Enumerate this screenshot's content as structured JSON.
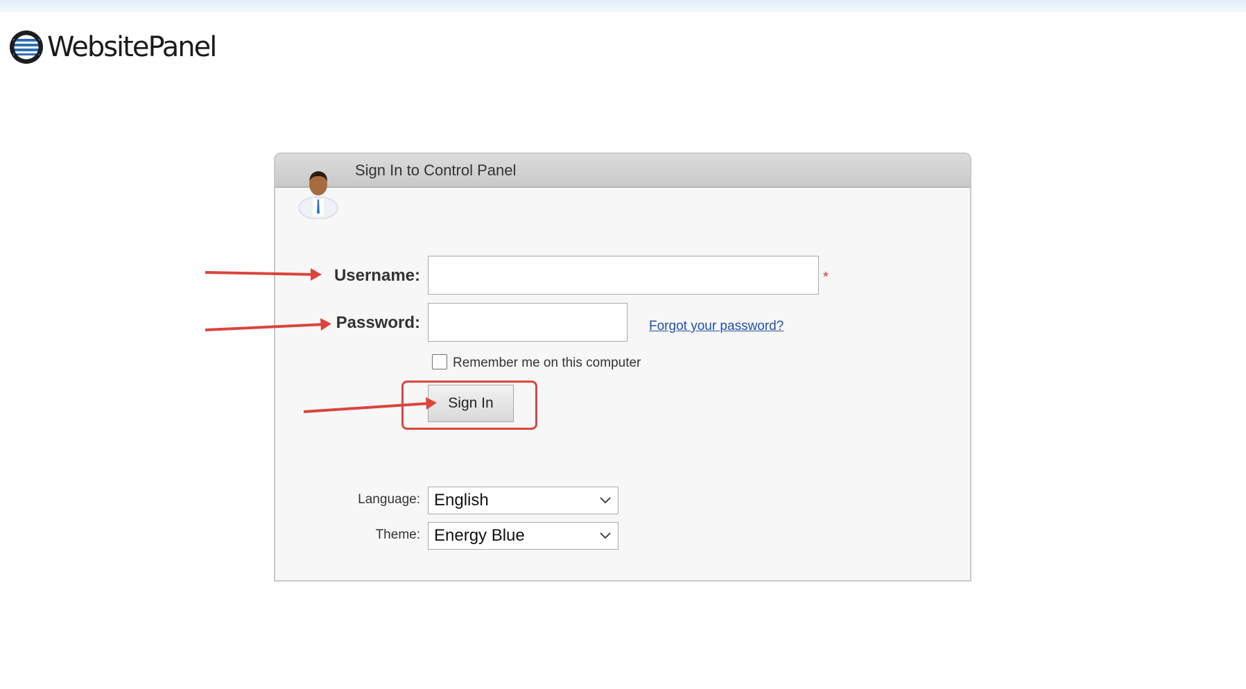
{
  "app": {
    "logo_text": "WebsitePanel"
  },
  "login_panel": {
    "title": "Sign In to Control Panel",
    "username_label": "Username:",
    "username_value": "",
    "required_marker": "*",
    "password_label": "Password:",
    "password_value": "",
    "forgot_password_link": "Forgot your password?",
    "remember_me_label": "Remember me on this computer",
    "remember_me_checked": false,
    "sign_in_button": "Sign In",
    "language_label": "Language:",
    "language_selected": "English",
    "theme_label": "Theme:",
    "theme_selected": "Energy Blue"
  },
  "icons": {
    "logo": "globe-logo-icon",
    "avatar": "user-avatar-icon",
    "dropdown": "chevron-down-icon"
  },
  "colors": {
    "annotation_red": "#d9453e",
    "link_blue": "#1f4fa8",
    "panel_header": "#cccccc",
    "panel_body": "#f7f7f7"
  }
}
